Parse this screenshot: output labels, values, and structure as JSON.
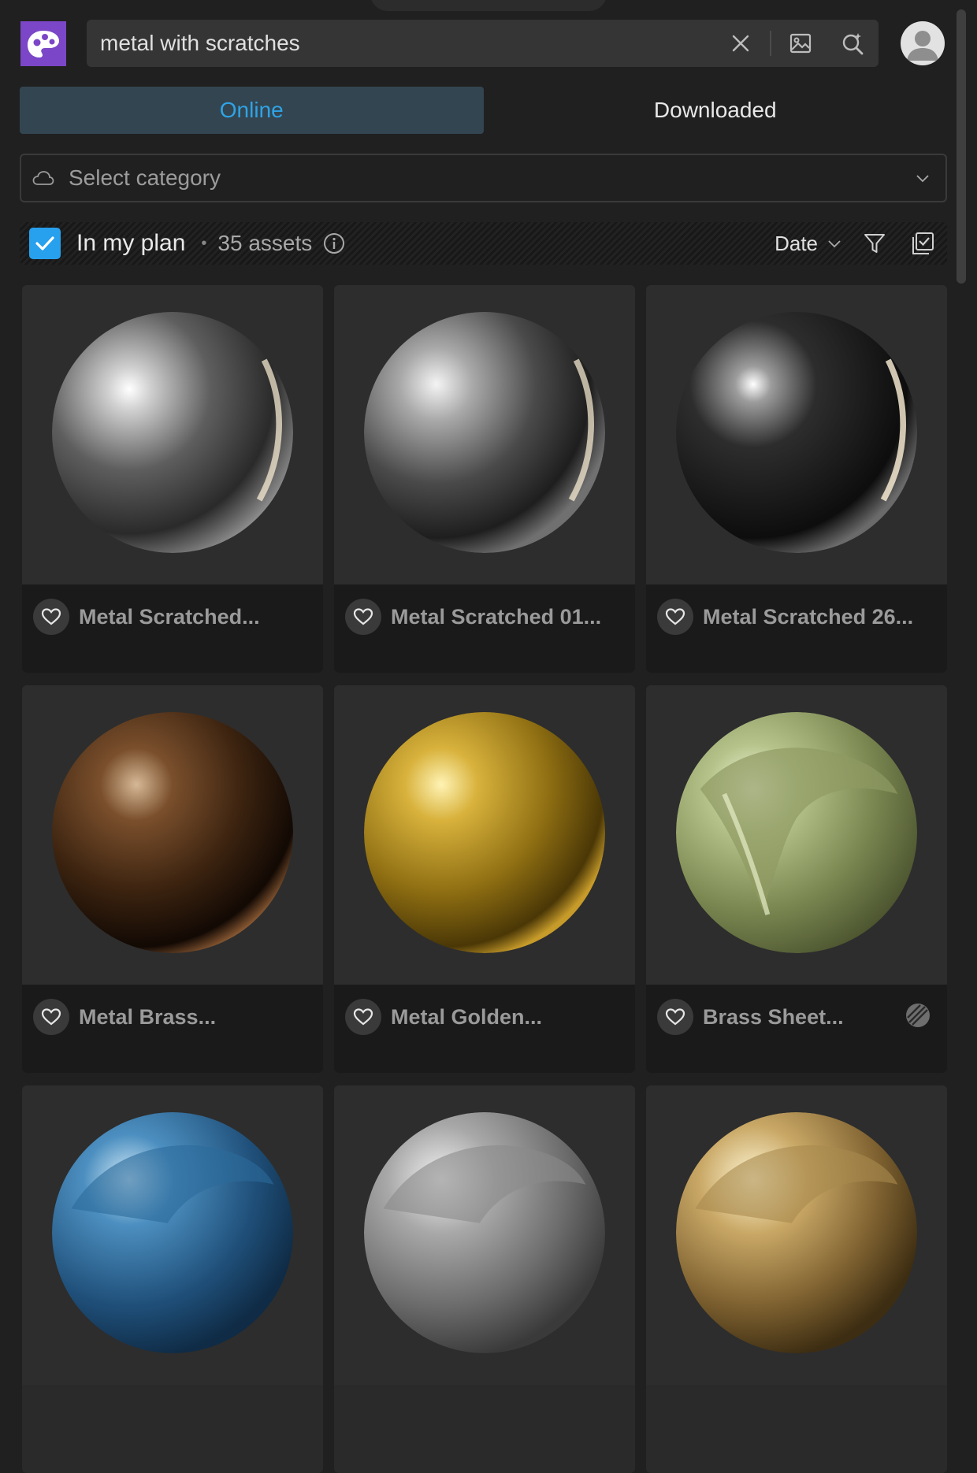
{
  "search": {
    "query": "metal with scratches",
    "icons": [
      "close-icon",
      "image-search-icon",
      "ai-search-icon"
    ]
  },
  "tabs": [
    {
      "label": "Online",
      "active": true
    },
    {
      "label": "Downloaded",
      "active": false
    }
  ],
  "category": {
    "placeholder": "Select category",
    "icon": "cloud-icon"
  },
  "filter_bar": {
    "plan_label": "In my plan",
    "plan_checked": true,
    "separator": "•",
    "asset_count": "35 assets",
    "sort_label": "Date",
    "icons": [
      "info-icon",
      "chevron-down-icon",
      "filter-icon",
      "select-all-icon"
    ]
  },
  "assets": [
    {
      "name": "Metal Scratched...",
      "favorited": false
    },
    {
      "name": "Metal Scratched 01...",
      "favorited": false
    },
    {
      "name": "Metal Scratched 26...",
      "favorited": false
    },
    {
      "name": "Metal Brass...",
      "favorited": false
    },
    {
      "name": "Metal Golden...",
      "favorited": false
    },
    {
      "name": "Brass Sheet...",
      "favorited": false,
      "badge": "material-badge-icon"
    },
    {
      "name": "",
      "favorited": false
    },
    {
      "name": "",
      "favorited": false
    },
    {
      "name": "",
      "favorited": false
    }
  ],
  "colors": {
    "accent": "#27a0ee",
    "tab_active_bg": "#334550",
    "logo": "#7b46c7"
  }
}
